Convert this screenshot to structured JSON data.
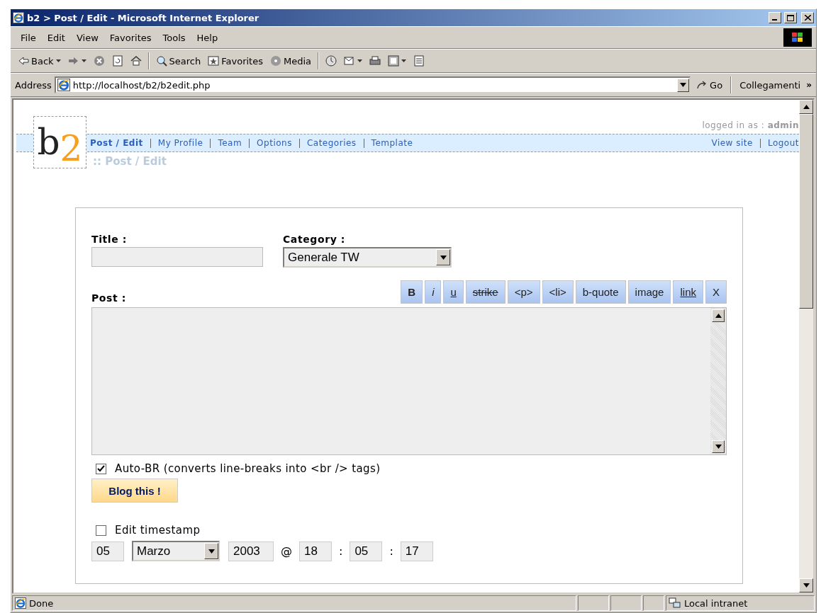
{
  "window": {
    "title": "b2 > Post / Edit - Microsoft Internet Explorer"
  },
  "menu": [
    "File",
    "Edit",
    "View",
    "Favorites",
    "Tools",
    "Help"
  ],
  "toolbar": [
    {
      "kind": "back",
      "label": "Back"
    },
    {
      "kind": "forward"
    },
    {
      "kind": "stop"
    },
    {
      "kind": "refresh"
    },
    {
      "kind": "home"
    },
    {
      "kind": "search",
      "label": "Search"
    },
    {
      "kind": "favorites",
      "label": "Favorites"
    },
    {
      "kind": "media",
      "label": "Media"
    },
    {
      "kind": "history"
    },
    {
      "kind": "mail"
    },
    {
      "kind": "print"
    },
    {
      "kind": "edit"
    },
    {
      "kind": "discuss"
    }
  ],
  "address_bar": {
    "label": "Address",
    "url": "http://localhost/b2/b2edit.php",
    "go": "Go",
    "links": "Collegamenti",
    "more": "»"
  },
  "page": {
    "logo": {
      "letter": "b",
      "digit": "2"
    },
    "login": "logged in as : **admin**",
    "nav": [
      {
        "label": "Post / Edit",
        "selected": true
      },
      {
        "label": "My Profile",
        "selected": false
      },
      {
        "label": "Team",
        "selected": false
      },
      {
        "label": "Options",
        "selected": false
      },
      {
        "label": "Categories",
        "selected": false
      },
      {
        "label": "Template",
        "selected": false
      }
    ],
    "nav_right": [
      "View site",
      "Logout"
    ],
    "heading": ":: Post / Edit",
    "form": {
      "title_label": "Title :",
      "category_label": "Category :",
      "category": "Generale TW",
      "post_label": "Post :",
      "format_buttons": [
        {
          "label": "B",
          "kind": "bold"
        },
        {
          "label": "i",
          "kind": "italic"
        },
        {
          "label": "u",
          "kind": "underline"
        },
        {
          "label": "strike",
          "kind": "strike"
        },
        {
          "label": "<p>",
          "kind": "plain"
        },
        {
          "label": "<li>",
          "kind": "plain"
        },
        {
          "label": "b-quote",
          "kind": "plain"
        },
        {
          "label": "image",
          "kind": "plain"
        },
        {
          "label": "link",
          "kind": "underline"
        },
        {
          "label": "X",
          "kind": "plain"
        }
      ],
      "auto_br": {
        "label": "Auto-BR (converts line-breaks into <br /> tags)",
        "checked": true
      },
      "submit": "Blog this !",
      "edit_timestamp": {
        "label": "Edit timestamp",
        "checked": false
      },
      "timestamp": {
        "day": "05",
        "month": "Marzo",
        "year": "2003",
        "at": "@",
        "hour": "18",
        "sep_1": ":",
        "minute": "05",
        "sep_2": ":",
        "second": "17"
      }
    }
  },
  "status_bar": {
    "text": "Done",
    "zone": "Local intranet"
  }
}
